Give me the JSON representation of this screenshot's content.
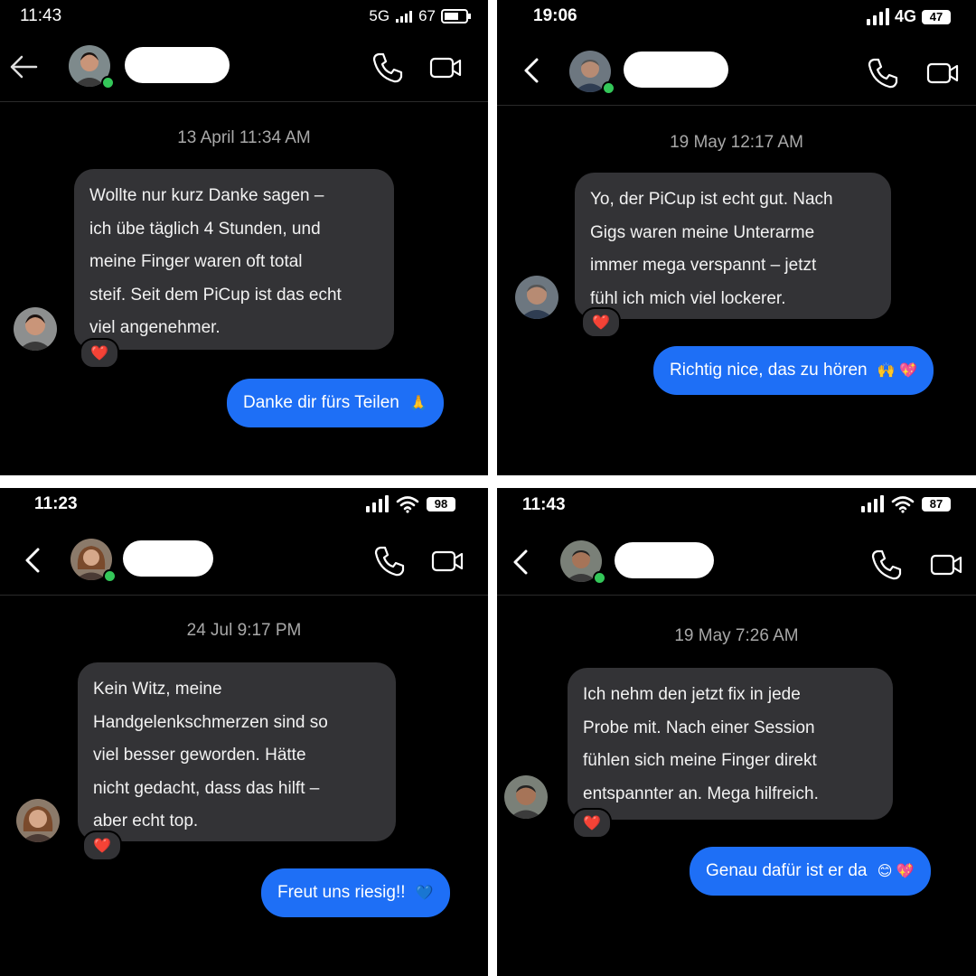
{
  "panels": [
    {
      "status": {
        "time": "11:43",
        "network": "5G",
        "battery": "67"
      },
      "timestamp": "13 April 11:34 AM",
      "incoming": [
        "Wollte nur kurz Danke sagen –",
        "ich übe täglich 4 Stunden, und",
        "meine Finger waren oft total",
        "steif. Seit dem PiCup ist das echt",
        "viel angenehmer."
      ],
      "reaction": "❤️",
      "outgoing": "Danke dir fürs Teilen",
      "outgoing_emoji": "🙏",
      "avatar_color": "#c99579"
    },
    {
      "status": {
        "time": "19:06",
        "network": "4G",
        "battery": "47"
      },
      "timestamp": "19 May 12:17 AM",
      "incoming": [
        "Yo, der PiCup ist echt gut. Nach",
        "Gigs waren meine Unterarme",
        "immer mega verspannt – jetzt",
        "fühl ich mich viel lockerer."
      ],
      "reaction": "❤️",
      "outgoing": "Richtig nice, das zu hören",
      "outgoing_emoji": "🙌 💖",
      "avatar_color": "#b78b73"
    },
    {
      "status": {
        "time": "11:23",
        "network": "",
        "battery": "98"
      },
      "timestamp": "24 Jul 9:17 PM",
      "incoming": [
        "Kein Witz, meine",
        "Handgelenkschmerzen sind so",
        "viel besser geworden. Hätte",
        "nicht gedacht, dass das hilft –",
        "aber echt top."
      ],
      "reaction": "❤️",
      "outgoing": "Freut uns riesig!!",
      "outgoing_emoji": "💙",
      "avatar_color": "#b97d5e"
    },
    {
      "status": {
        "time": "11:43",
        "network": "",
        "battery": "87"
      },
      "timestamp": "19 May 7:26 AM",
      "incoming": [
        "Ich nehm den jetzt fix in jede",
        "Probe mit. Nach einer Session",
        "fühlen sich meine Finger direkt",
        "entspannter an. Mega hilfreich."
      ],
      "reaction": "❤️",
      "outgoing": "Genau dafür ist er da",
      "outgoing_emoji": "😊 💖",
      "avatar_color": "#a67458"
    }
  ],
  "colors": {
    "outgoing_bubble": "#1e6ff6",
    "incoming_bubble": "#333336",
    "online": "#34c759",
    "timestamp": "#a8a8a8"
  }
}
